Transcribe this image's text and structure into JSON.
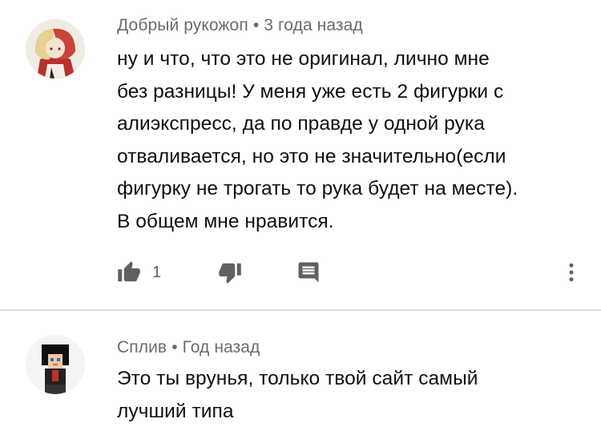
{
  "comments": [
    {
      "author": "Добрый рукожоп",
      "separator": "•",
      "time": "3 года назад",
      "lines": [
        "ну и что, что это не оригинал, лично мне",
        "без разницы! У меня уже есть 2 фигурки с",
        "алиэкспресс, да по правде у одной рука",
        "отваливается, но это не значительно(если",
        "фигурку не трогать то рука будет на месте).",
        "В общем мне нравится."
      ],
      "like_count": "1"
    },
    {
      "author": "Сплив",
      "separator": "•",
      "time": "Год назад",
      "lines": [
        "Это ты врунья, только твой сайт самый",
        "лучший типа"
      ]
    }
  ],
  "icons": {
    "like": "thumbs-up-icon",
    "dislike": "thumbs-down-icon",
    "reply": "reply-comment-icon",
    "more": "more-vertical-icon"
  },
  "colors": {
    "meta_text": "#6b6b6b",
    "body_text": "#0f0f0f",
    "icon": "#606060",
    "divider": "#dcdcdc"
  }
}
